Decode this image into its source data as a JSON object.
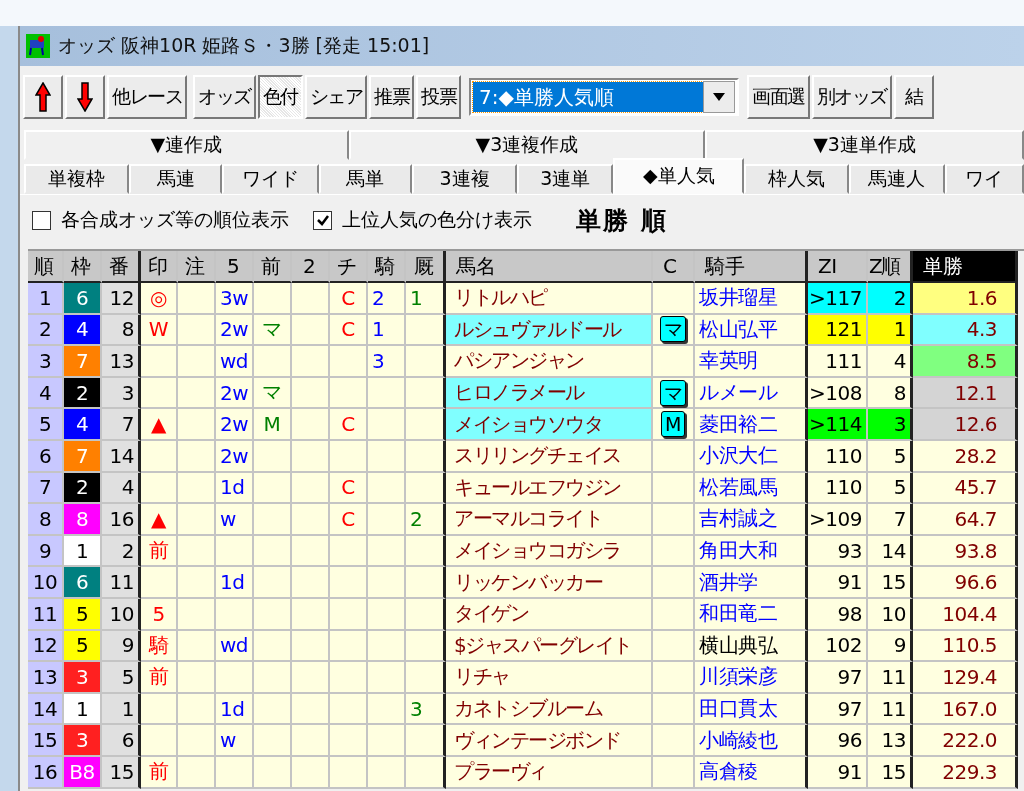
{
  "window": {
    "title": "オッズ 阪神10R 姫路Ｓ・3勝 [発走 15:01]"
  },
  "toolbar": {
    "groups": [
      [
        {
          "kind": "up-arrow",
          "pressed": false
        },
        {
          "kind": "down-arrow",
          "pressed": false
        },
        {
          "kind": "button",
          "label": "他レース",
          "pressed": false
        }
      ],
      [
        {
          "kind": "button",
          "label": "オッズ",
          "pressed": false
        },
        {
          "kind": "button",
          "label": "色付",
          "pressed": true
        },
        {
          "kind": "button",
          "label": "シェア",
          "pressed": false
        },
        {
          "kind": "button",
          "label": "推票",
          "pressed": false
        },
        {
          "kind": "button",
          "label": "投票",
          "pressed": false
        }
      ],
      [
        {
          "kind": "dropdown",
          "value": "7:◆単勝人気順"
        }
      ],
      [
        {
          "kind": "button",
          "label": "画面選",
          "pressed": false
        },
        {
          "kind": "button",
          "label": "別オッズ",
          "pressed": false
        },
        {
          "kind": "button",
          "label": "結",
          "pressed": false
        }
      ]
    ]
  },
  "group_tabs": [
    {
      "label": "▼連作成"
    },
    {
      "label": "▼3連複作成"
    },
    {
      "label": "▼3連単作成"
    }
  ],
  "tabs": [
    {
      "label": "単複枠",
      "selected": false
    },
    {
      "label": "馬連",
      "selected": false
    },
    {
      "label": "ワイド",
      "selected": false
    },
    {
      "label": "馬単",
      "selected": false
    },
    {
      "label": "3連複",
      "selected": false
    },
    {
      "label": "3連単",
      "selected": false
    },
    {
      "label": "◆単人気",
      "selected": true
    },
    {
      "label": "枠人気",
      "selected": false
    },
    {
      "label": "馬連人",
      "selected": false
    },
    {
      "label": "ワイ",
      "selected": false
    }
  ],
  "options": [
    {
      "label": "各合成オッズ等の順位表示",
      "checked": false
    },
    {
      "label": "上位人気の色分け表示",
      "checked": true
    }
  ],
  "heading": "単勝 順",
  "table": {
    "columns": [
      "順",
      "枠",
      "番",
      "印",
      "注",
      "5",
      "前",
      "2",
      "チ",
      "騎",
      "厩",
      "馬名",
      "C",
      "騎手",
      "ZI",
      "Z順",
      "単勝"
    ],
    "rows": [
      {
        "rank": "1",
        "frame": {
          "text": "6",
          "color": "#008080"
        },
        "number": "12",
        "mark": "◎",
        "c5": "3w",
        "chi": "C",
        "ki": "2",
        "kyu": "1",
        "name": "リトルハピ",
        "highlighted": false,
        "jockey": {
          "text": "坂井瑠星",
          "color": "#0000ff"
        },
        "zi": {
          "text": ">117",
          "color": "#00ffff"
        },
        "z_rank": {
          "text": "2",
          "color": "#00ffff"
        },
        "odds": {
          "text": "1.6",
          "color": "#ffff80"
        }
      },
      {
        "rank": "2",
        "frame": {
          "text": "4",
          "color": "#0000ff"
        },
        "number": "8",
        "mark": "W",
        "c5": "2w",
        "prev": "マ",
        "chi": "C",
        "ki": "1",
        "name": "ルシュヴァルドール",
        "highlighted": true,
        "badge": "マ",
        "jockey": {
          "text": "松山弘平",
          "color": "#0000ff"
        },
        "zi": {
          "text": "121",
          "color": "#ffff00"
        },
        "z_rank": {
          "text": "1",
          "color": "#ffff00"
        },
        "odds": {
          "text": "4.3",
          "color": "#80ffff"
        }
      },
      {
        "rank": "3",
        "frame": {
          "text": "7",
          "color": "#ff8000"
        },
        "number": "13",
        "c5": "wd",
        "ki": "3",
        "name": "パシアンジャン",
        "highlighted": false,
        "jockey": {
          "text": "幸英明",
          "color": "#0000ff"
        },
        "zi": {
          "text": "111"
        },
        "z_rank": {
          "text": "4"
        },
        "odds": {
          "text": "8.5",
          "color": "#80ff80"
        }
      },
      {
        "rank": "4",
        "frame": {
          "text": "2",
          "color": "#000000"
        },
        "number": "3",
        "c5": "2w",
        "prev": "マ",
        "name": "ヒロノラメール",
        "highlighted": true,
        "badge": "マ",
        "jockey": {
          "text": "ルメール",
          "color": "#0000ff"
        },
        "zi": {
          "text": ">108"
        },
        "z_rank": {
          "text": "8"
        },
        "odds": {
          "text": "12.1",
          "color": "#d4d4d4"
        }
      },
      {
        "rank": "5",
        "frame": {
          "text": "4",
          "color": "#0000ff"
        },
        "number": "7",
        "mark": "▲",
        "c5": "2w",
        "prev": "M",
        "chi": "C",
        "name": "メイショウソウタ",
        "highlighted": true,
        "badge": "M",
        "jockey": {
          "text": "菱田裕二",
          "color": "#0000ff"
        },
        "zi": {
          "text": ">114",
          "color": "#00ff00"
        },
        "z_rank": {
          "text": "3",
          "color": "#00ff00"
        },
        "odds": {
          "text": "12.6",
          "color": "#d4d4d4"
        }
      },
      {
        "rank": "6",
        "frame": {
          "text": "7",
          "color": "#ff8000"
        },
        "number": "14",
        "c5": "2w",
        "name": "スリリングチェイス",
        "highlighted": false,
        "jockey": {
          "text": "小沢大仁",
          "color": "#0000ff"
        },
        "zi": {
          "text": "110"
        },
        "z_rank": {
          "text": "5"
        },
        "odds": {
          "text": "28.2"
        }
      },
      {
        "rank": "7",
        "frame": {
          "text": "2",
          "color": "#000000"
        },
        "number": "4",
        "c5": "1d",
        "chi": "C",
        "name": "キュールエフウジン",
        "highlighted": false,
        "jockey": {
          "text": "松若風馬",
          "color": "#0000ff"
        },
        "zi": {
          "text": "110"
        },
        "z_rank": {
          "text": "5"
        },
        "odds": {
          "text": "45.7"
        }
      },
      {
        "rank": "8",
        "frame": {
          "text": "8",
          "color": "#ff00ff"
        },
        "number": "16",
        "mark": "▲",
        "c5": "w",
        "chi": "C",
        "kyu": "2",
        "name": "アーマルコライト",
        "highlighted": false,
        "jockey": {
          "text": "吉村誠之",
          "color": "#0000ff"
        },
        "zi": {
          "text": ">109"
        },
        "z_rank": {
          "text": "7"
        },
        "odds": {
          "text": "64.7"
        }
      },
      {
        "rank": "9",
        "frame": {
          "text": "1",
          "color": "#ffffff"
        },
        "number": "2",
        "mark": "前",
        "name": "メイショウコガシラ",
        "highlighted": false,
        "jockey": {
          "text": "角田大和",
          "color": "#0000ff"
        },
        "zi": {
          "text": "93"
        },
        "z_rank": {
          "text": "14"
        },
        "odds": {
          "text": "93.8"
        }
      },
      {
        "rank": "10",
        "frame": {
          "text": "6",
          "color": "#008080"
        },
        "number": "11",
        "c5": "1d",
        "name": "リッケンバッカー",
        "highlighted": false,
        "jockey": {
          "text": "酒井学",
          "color": "#0000ff"
        },
        "zi": {
          "text": "91"
        },
        "z_rank": {
          "text": "15"
        },
        "odds": {
          "text": "96.6"
        }
      },
      {
        "rank": "11",
        "frame": {
          "text": "5",
          "color": "#ffff00"
        },
        "number": "10",
        "mark": "5",
        "name": "タイゲン",
        "highlighted": false,
        "jockey": {
          "text": "和田竜二",
          "color": "#0000ff"
        },
        "zi": {
          "text": "98"
        },
        "z_rank": {
          "text": "10"
        },
        "odds": {
          "text": "104.4"
        }
      },
      {
        "rank": "12",
        "frame": {
          "text": "5",
          "color": "#ffff00"
        },
        "number": "9",
        "mark": "騎",
        "c5": "wd",
        "name": "$ジャスパーグレイト",
        "highlighted": false,
        "jockey": {
          "text": "横山典弘",
          "color": "#000000"
        },
        "zi": {
          "text": "102"
        },
        "z_rank": {
          "text": "9"
        },
        "odds": {
          "text": "110.5"
        }
      },
      {
        "rank": "13",
        "frame": {
          "text": "3",
          "color": "#ff2020"
        },
        "number": "5",
        "mark": "前",
        "name": "リチャ",
        "highlighted": false,
        "jockey": {
          "text": "川須栄彦",
          "color": "#0000ff"
        },
        "zi": {
          "text": "97"
        },
        "z_rank": {
          "text": "11"
        },
        "odds": {
          "text": "129.4"
        }
      },
      {
        "rank": "14",
        "frame": {
          "text": "1",
          "color": "#ffffff"
        },
        "number": "1",
        "c5": "1d",
        "kyu": "3",
        "name": "カネトシブルーム",
        "highlighted": false,
        "jockey": {
          "text": "田口貫太",
          "color": "#0000ff"
        },
        "zi": {
          "text": "97"
        },
        "z_rank": {
          "text": "11"
        },
        "odds": {
          "text": "167.0"
        }
      },
      {
        "rank": "15",
        "frame": {
          "text": "3",
          "color": "#ff2020"
        },
        "number": "6",
        "c5": "w",
        "name": "ヴィンテージボンド",
        "highlighted": false,
        "jockey": {
          "text": "小崎綾也",
          "color": "#0000ff"
        },
        "zi": {
          "text": "96"
        },
        "z_rank": {
          "text": "13"
        },
        "odds": {
          "text": "222.0"
        }
      },
      {
        "rank": "16",
        "frame": {
          "text": "B8",
          "color": "#ff00ff"
        },
        "number": "15",
        "mark": "前",
        "name": "プラーヴィ",
        "highlighted": false,
        "jockey": {
          "text": "高倉稜",
          "color": "#0000ff"
        },
        "zi": {
          "text": "91"
        },
        "z_rank": {
          "text": "15"
        },
        "odds": {
          "text": "229.3"
        }
      }
    ]
  }
}
